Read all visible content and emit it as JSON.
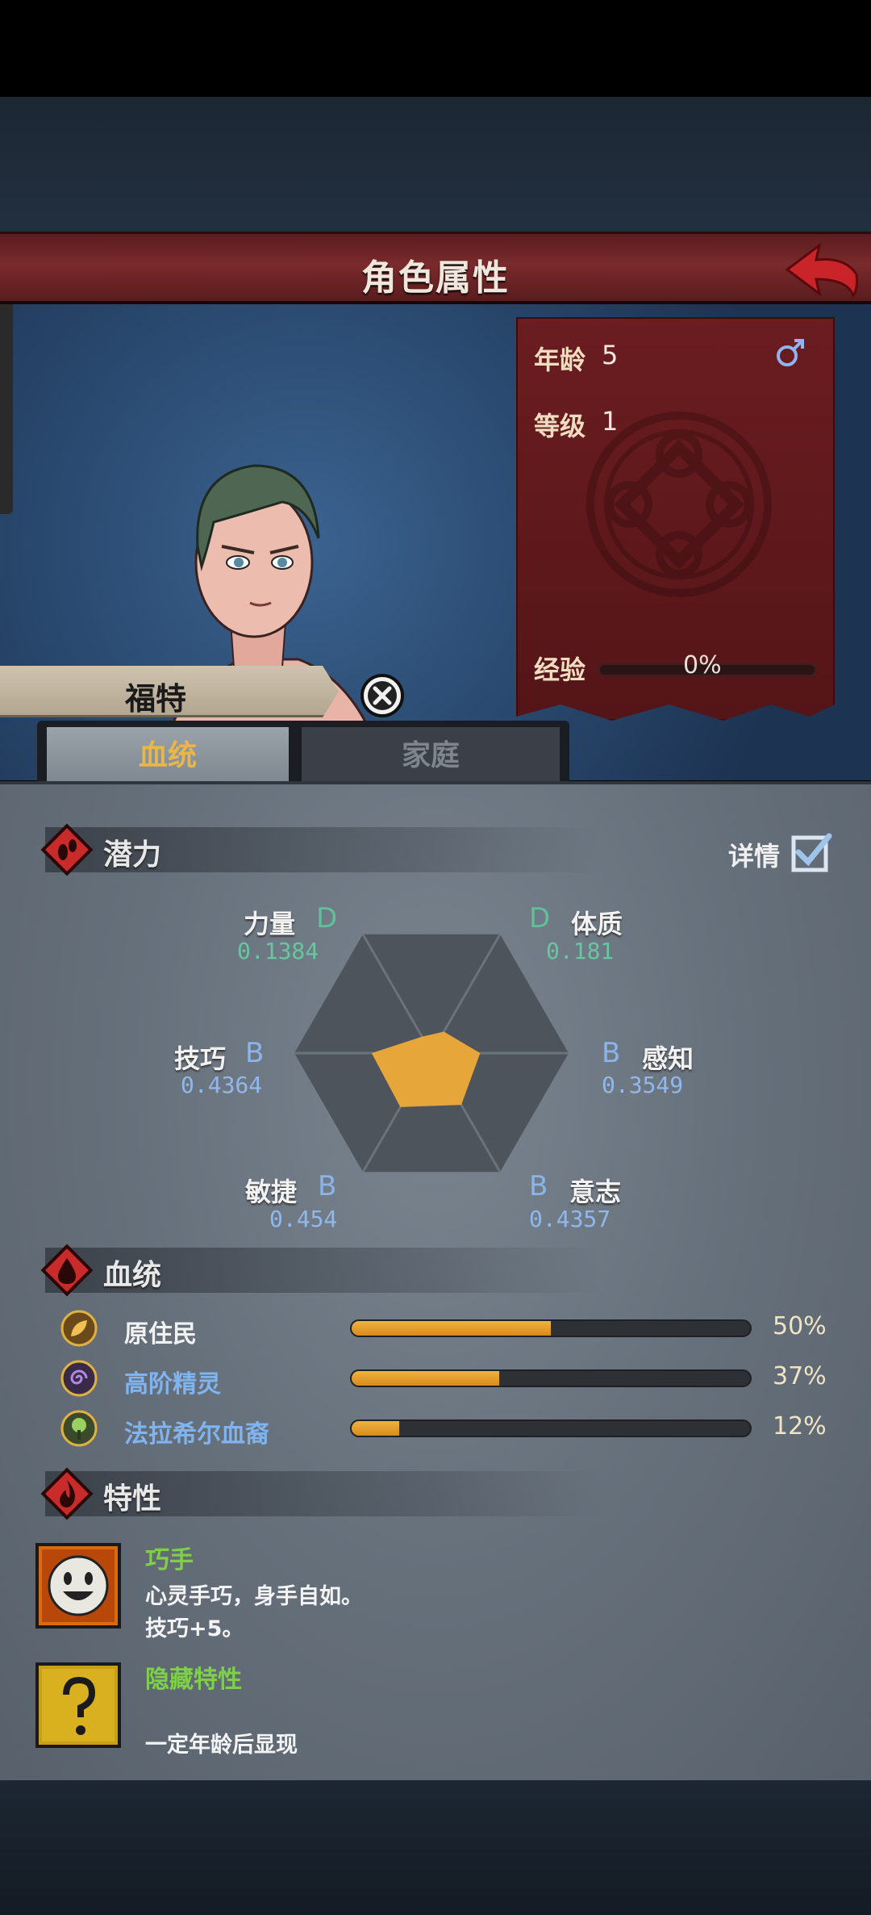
{
  "header": {
    "title": "角色属性",
    "back_icon": "back-arrow-icon"
  },
  "character": {
    "name": "福特"
  },
  "info": {
    "age_label": "年龄",
    "age_value": "5",
    "level_label": "等级",
    "level_value": "1",
    "exp_label": "经验",
    "exp_value": "0%",
    "exp_fraction": 0,
    "gender_icon": "male-icon"
  },
  "tabs": [
    {
      "label": "血统",
      "active": true
    },
    {
      "label": "家庭",
      "active": false
    }
  ],
  "potential": {
    "title": "潜力",
    "details_label": "详情",
    "details_checked": true,
    "stats": [
      {
        "name": "力量",
        "grade": "D",
        "value": "0.1384"
      },
      {
        "name": "体质",
        "grade": "D",
        "value": "0.181"
      },
      {
        "name": "感知",
        "grade": "B",
        "value": "0.3549"
      },
      {
        "name": "意志",
        "grade": "B",
        "value": "0.4357"
      },
      {
        "name": "敏捷",
        "grade": "B",
        "value": "0.454"
      },
      {
        "name": "技巧",
        "grade": "B",
        "value": "0.4364"
      }
    ]
  },
  "bloodline": {
    "title": "血统",
    "items": [
      {
        "name": "原住民",
        "percent": "50%",
        "fraction": 0.5,
        "color": "#f2f2f2",
        "icon": "leaf-icon"
      },
      {
        "name": "高阶精灵",
        "percent": "37%",
        "fraction": 0.37,
        "color": "#7fb4f0",
        "icon": "spiral-icon"
      },
      {
        "name": "法拉希尔血裔",
        "percent": "12%",
        "fraction": 0.12,
        "color": "#7fb4f0",
        "icon": "tree-icon"
      }
    ]
  },
  "traits": {
    "title": "特性",
    "items": [
      {
        "name": "巧手",
        "desc1": "心灵手巧，身手自如。",
        "desc2": "技巧+5。",
        "icon": "smile-face-icon"
      },
      {
        "name": "隐藏特性",
        "desc1": "",
        "desc2": "一定年龄后显现",
        "icon": "question-mark-icon"
      }
    ]
  },
  "colors": {
    "header": "#6a2022",
    "accent": "#e8b64a",
    "radar_fill": "#e6a63a"
  }
}
